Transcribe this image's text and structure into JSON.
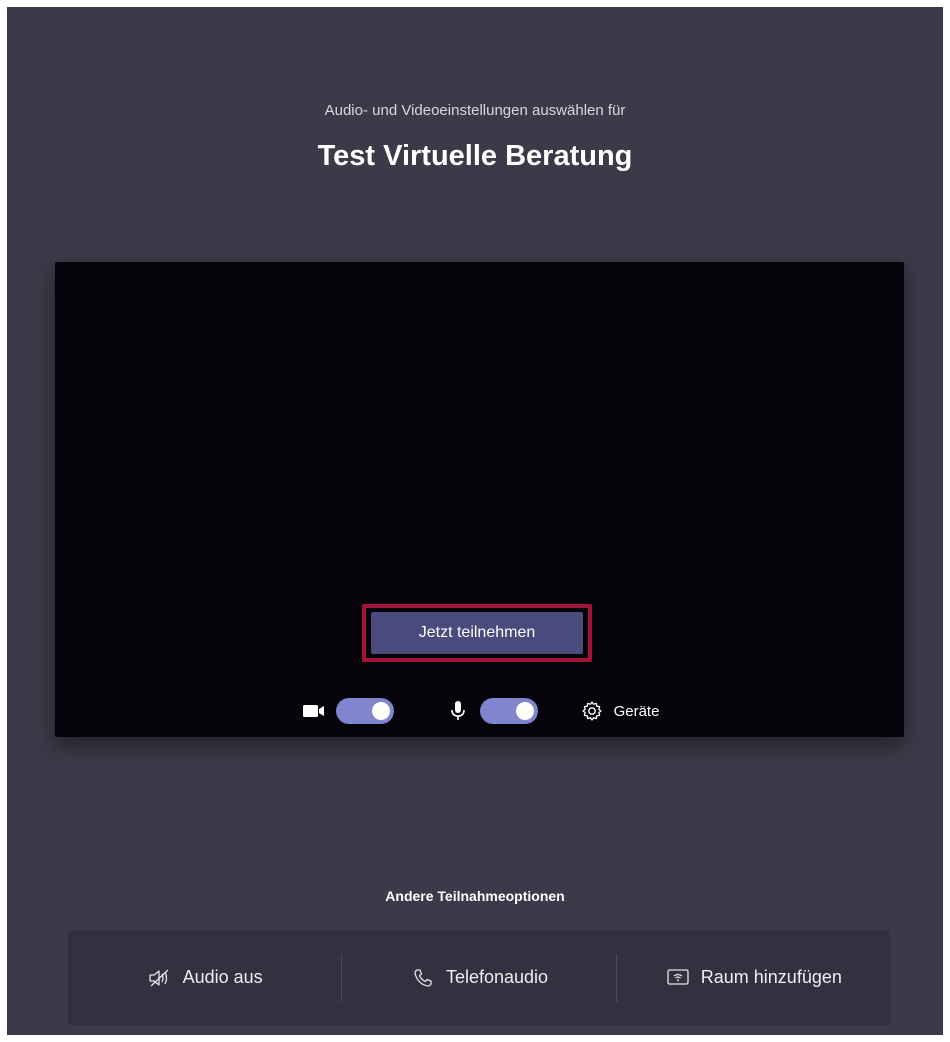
{
  "header": {
    "subtitle": "Audio- und Videoeinstellungen auswählen für",
    "meeting_title": "Test Virtuelle Beratung"
  },
  "preview": {
    "join_button_label": "Jetzt teilnehmen",
    "camera_toggle_on": true,
    "mic_toggle_on": true,
    "devices_label": "Geräte"
  },
  "other_options": {
    "heading": "Andere Teilnahmeoptionen",
    "items": [
      {
        "label": "Audio aus",
        "icon": "speaker-off-icon"
      },
      {
        "label": "Telefonaudio",
        "icon": "phone-icon"
      },
      {
        "label": "Raum hinzufügen",
        "icon": "cast-room-icon"
      }
    ]
  },
  "colors": {
    "background": "#3b3a48",
    "preview": "#07030a",
    "accent": "#7f85cc",
    "join_button": "#4a4b7d",
    "highlight_frame": "#a3143a"
  }
}
